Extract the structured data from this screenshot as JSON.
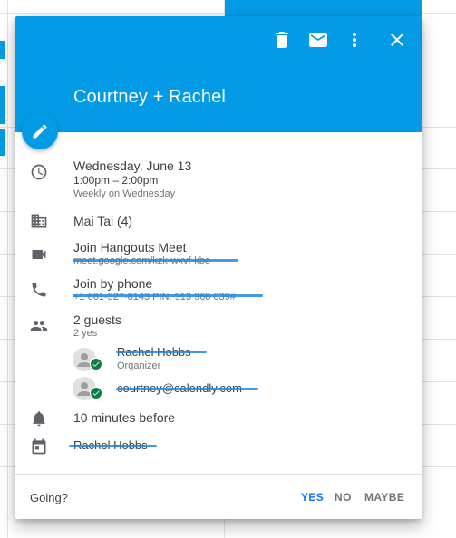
{
  "popup": {
    "title": "Courtney + Rachel",
    "header_actions": [
      "delete-icon",
      "email-icon",
      "more-vert-icon",
      "close-icon"
    ],
    "accent_color": "#039be5"
  },
  "details": {
    "date": "Wednesday, June 13",
    "time": "1:00pm – 2:00pm",
    "recurrence": "Weekly on Wednesday",
    "room": "Mai Tai (4)",
    "hangouts_label": "Join Hangouts Meet",
    "hangouts_link": "meet.google.com/kzk-wxvf-kbe",
    "phone_label": "Join by phone",
    "phone_number": "+1 661-327-8143 PIN: 913 968 039#",
    "guests_count": "2 guests",
    "guests_summary": "2 yes",
    "guests": [
      {
        "name": "Rachel Hobbs",
        "role": "Organizer"
      },
      {
        "name": "courtney@calendly.com",
        "role": ""
      }
    ],
    "reminder": "10 minutes before",
    "calendar_owner": "Rachel Hobbs"
  },
  "footer": {
    "going_label": "Going?",
    "yes": "YES",
    "no": "NO",
    "maybe": "MAYBE",
    "selected": "YES"
  }
}
